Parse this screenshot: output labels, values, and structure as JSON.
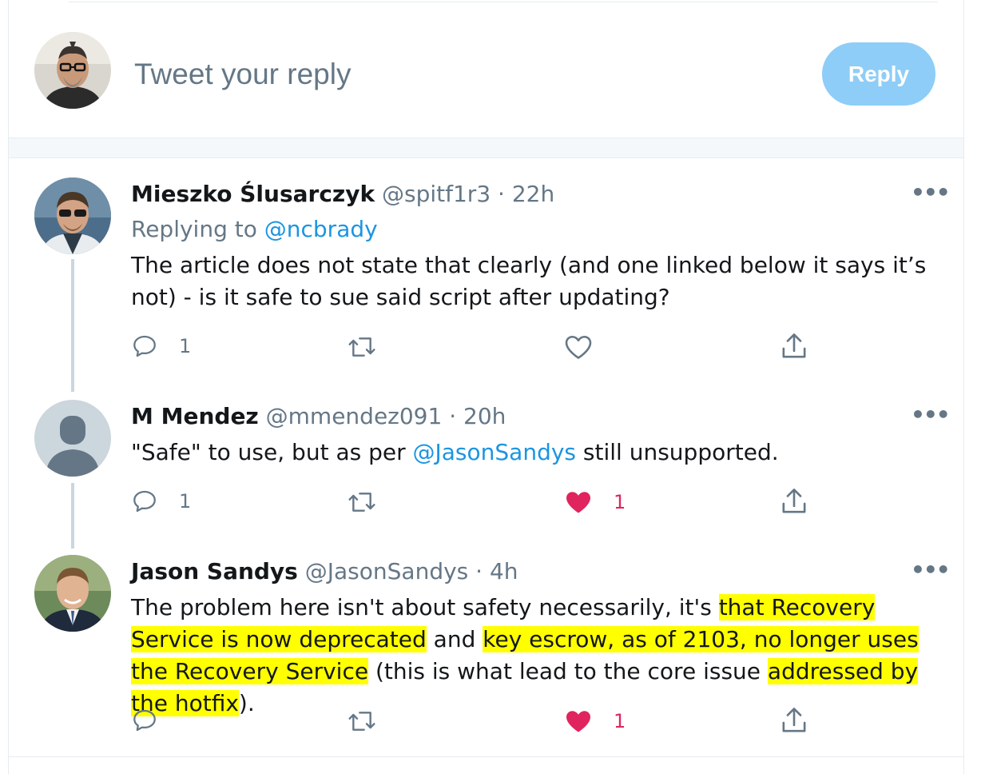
{
  "composer": {
    "placeholder": "Tweet your reply",
    "reply_label": "Reply"
  },
  "tweets": [
    {
      "name": "Mieszko Ślusarczyk",
      "handle": "@spitf1r3",
      "time": "· 22h",
      "replying_prefix": "Replying to ",
      "replying_to": "@ncbrady",
      "text": "The article does not state that clearly (and one linked below it says it’s not) - is it safe to sue said script after updating?",
      "reply_count": "1",
      "like_count": ""
    },
    {
      "name": "M Mendez",
      "handle": "@mmendez091",
      "time": "· 20h",
      "text_before": "\"Safe\" to use, but as per ",
      "mention": "@JasonSandys",
      "text_after": " still unsupported.",
      "reply_count": "1",
      "like_count": "1"
    },
    {
      "name": "Jason Sandys",
      "handle": "@JasonSandys",
      "time": "· 4h",
      "text_parts": [
        "The problem here isn't about safety necessarily, it's ",
        "that Recovery Service is now deprecated",
        " and ",
        "key escrow, as of 2103, no longer uses the Recovery Service",
        " (this is what lead to the core issue ",
        "addressed by the hotfix",
        ")."
      ],
      "reply_count": "",
      "like_count": "1"
    }
  ],
  "icons": {
    "reply": "speech-bubble-icon",
    "retweet": "retweet-icon",
    "like": "heart-icon",
    "share": "share-upload-icon",
    "more": "more-dots-icon"
  },
  "colors": {
    "accent": "#1b95e0",
    "reply_button": "#8ecdf7",
    "like": "#e0245e",
    "highlight": "#ffff00",
    "muted": "#657786"
  }
}
